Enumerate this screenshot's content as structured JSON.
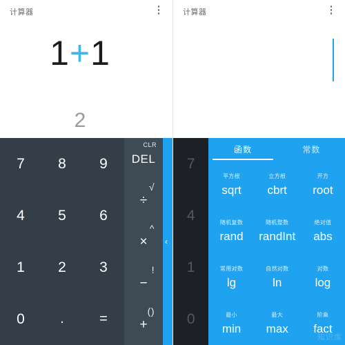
{
  "left_panel": {
    "appbar": {
      "title": "计算器",
      "menu_icon": "kebab-menu-icon"
    },
    "display": {
      "expression_left": "1",
      "expression_operator": "+",
      "expression_right": "1",
      "result": "2"
    },
    "numpad": {
      "keys": [
        "7",
        "8",
        "9",
        "4",
        "5",
        "6",
        "1",
        "2",
        "3",
        "0",
        ".",
        "="
      ]
    },
    "operator_column": {
      "cells": [
        {
          "sup": "CLR",
          "main": "DEL",
          "sup_kind": "text"
        },
        {
          "sup": "√",
          "main": "÷",
          "sup_kind": "glyph"
        },
        {
          "sup": "^",
          "main": "×",
          "sup_kind": "glyph"
        },
        {
          "sup": "!",
          "main": "−",
          "sup_kind": "glyph"
        },
        {
          "sup": "()",
          "main": "+",
          "sup_kind": "glyph"
        }
      ]
    },
    "edge_strip": {
      "chevron": "‹",
      "color": "#1fa3f0"
    }
  },
  "right_panel": {
    "appbar": {
      "title": "计算器",
      "menu_icon": "kebab-menu-icon"
    },
    "display": {
      "caret_color": "#1fa3f0"
    },
    "numpad": {
      "keys": [
        "7",
        "4",
        "1",
        "0"
      ]
    },
    "function_panel": {
      "background": "#1fa3f0",
      "tabs": [
        {
          "label": "函数",
          "active": true
        },
        {
          "label": "常数",
          "active": false
        }
      ],
      "functions": [
        {
          "cn": "平方根",
          "fn": "sqrt"
        },
        {
          "cn": "立方根",
          "fn": "cbrt"
        },
        {
          "cn": "开方",
          "fn": "root"
        },
        {
          "cn": "随机复数",
          "fn": "rand"
        },
        {
          "cn": "随机整数",
          "fn": "randInt"
        },
        {
          "cn": "绝对值",
          "fn": "abs"
        },
        {
          "cn": "常用对数",
          "fn": "lg"
        },
        {
          "cn": "自然对数",
          "fn": "ln"
        },
        {
          "cn": "对数",
          "fn": "log"
        },
        {
          "cn": "最小",
          "fn": "min"
        },
        {
          "cn": "最大",
          "fn": "max"
        },
        {
          "cn": "阶乘",
          "fn": "fact"
        }
      ],
      "watermark": "知识库"
    }
  }
}
